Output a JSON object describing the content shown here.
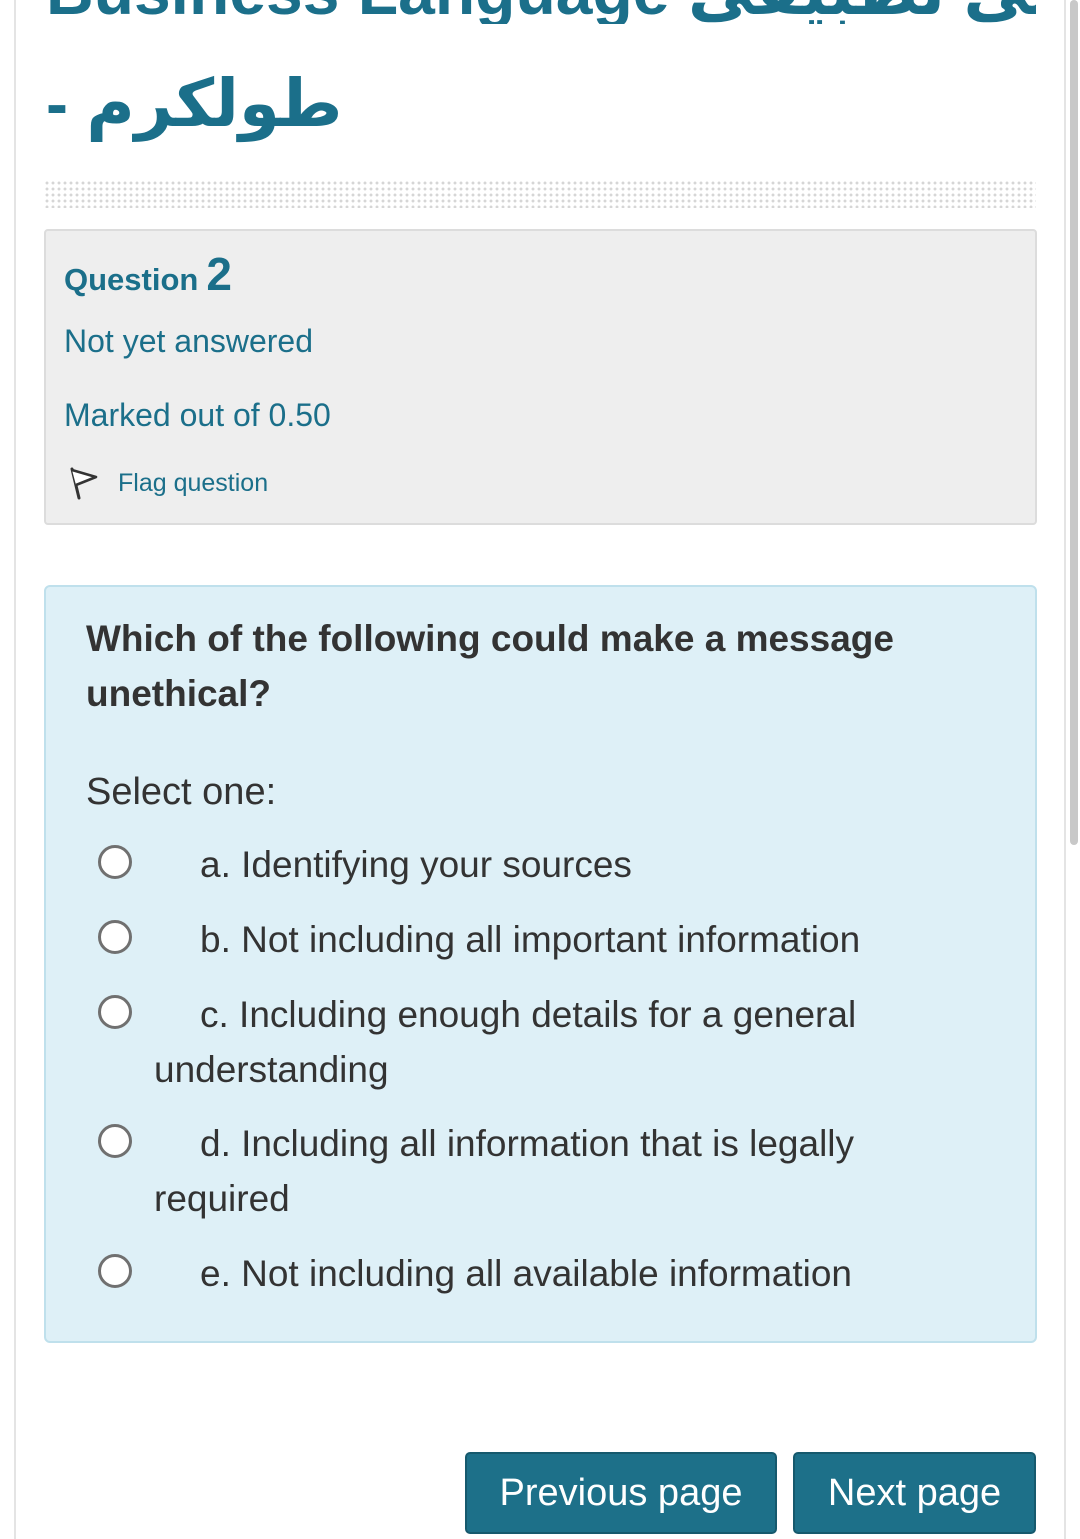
{
  "header": {
    "title_line1": "Business Language عربي تطبيقي",
    "title_line2": "طولكرم -"
  },
  "question_info": {
    "label": "Question",
    "number": "2",
    "state": "Not yet answered",
    "grade": "Marked out of 0.50",
    "flag_label": "Flag question"
  },
  "question": {
    "text": "Which of the following could make a message unethical?",
    "prompt": "Select one:",
    "options": [
      {
        "label": "a. Identifying your sources",
        "selected": false
      },
      {
        "label": "b. Not including all important information",
        "selected": false
      },
      {
        "label": "c. Including enough details for a general understanding",
        "selected": false
      },
      {
        "label": "d. Including all information that is legally required",
        "selected": false
      },
      {
        "label": "e. Not including all available information",
        "selected": false
      }
    ]
  },
  "navigation": {
    "previous_label": "Previous page",
    "next_label": "Next page"
  },
  "colors": {
    "accent": "#1b6f8a",
    "content_bg": "#def0f7",
    "info_bg": "#eeeeee",
    "button_bg": "#1d7089"
  },
  "icons": {
    "flag": "flag-icon",
    "radio": "radio-unchecked-icon"
  }
}
